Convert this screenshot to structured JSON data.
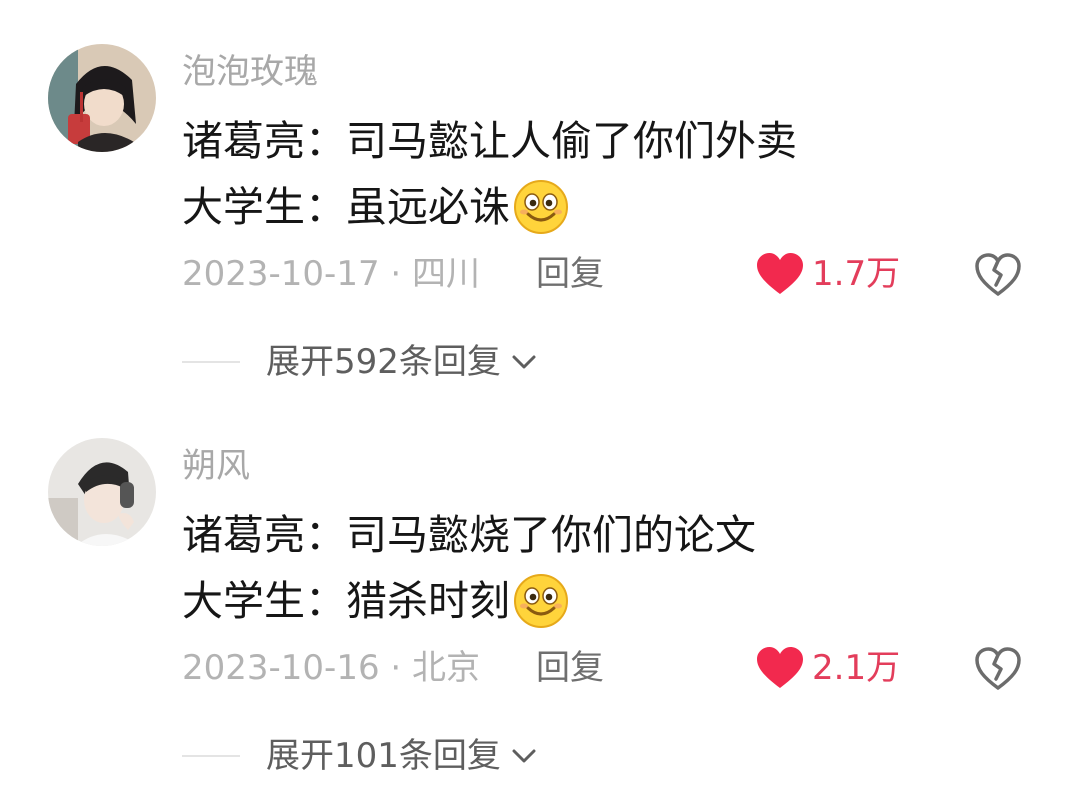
{
  "comments": [
    {
      "username": "泡泡玫瑰",
      "line1": "诸葛亮：司马懿让人偷了你们外卖",
      "line2": "大学生：虽远必诛",
      "date_location": "2023-10-17 · 四川",
      "reply_label": "回复",
      "like_count": "1.7万",
      "expand_label": "展开592条回复"
    },
    {
      "username": "朔风",
      "line1": "诸葛亮：司马懿烧了你们的论文",
      "line2": "大学生：猎杀时刻",
      "date_location": "2023-10-16 · 北京",
      "reply_label": "回复",
      "like_count": "2.1万",
      "expand_label": "展开101条回复"
    }
  ],
  "icons": {
    "like": "heart-icon",
    "dislike": "broken-heart-icon",
    "emoji": "smiling-face-emoji",
    "expand": "chevron-down-icon"
  },
  "colors": {
    "like_accent": "#e33d5b",
    "username": "#a8a8a8",
    "text": "#161616"
  }
}
